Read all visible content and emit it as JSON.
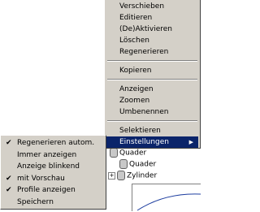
{
  "main_menu": {
    "group1": [
      "Verschieben",
      "Editieren",
      "(De)Aktivieren",
      "Löschen",
      "Regenerieren"
    ],
    "group2": [
      "Kopieren"
    ],
    "group3": [
      "Anzeigen",
      "Zoomen",
      "Umbenennen"
    ],
    "group4": [
      "Selektieren"
    ],
    "submenu_item": "Einstellungen"
  },
  "submenu": {
    "items": [
      {
        "label": "Regenerieren autom.",
        "checked": true
      },
      {
        "label": "Immer anzeigen",
        "checked": false
      },
      {
        "label": "Anzeige blinkend",
        "checked": false
      },
      {
        "label": "mit Vorschau",
        "checked": true
      },
      {
        "label": "Profile anzeigen",
        "checked": true
      },
      {
        "label": "Speichern",
        "checked": false
      }
    ]
  },
  "tree": {
    "items": [
      "Quader",
      "Quader",
      "Zylinder"
    ]
  },
  "colors": {
    "menu_bg": "#d4d0c8",
    "highlight": "#0a246a",
    "curve": "#1f3fa0"
  }
}
